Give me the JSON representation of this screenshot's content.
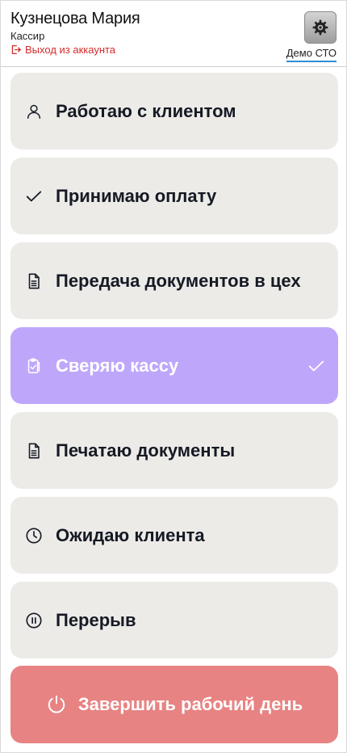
{
  "header": {
    "user_name": "Кузнецова Мария",
    "user_role": "Кассир",
    "logout_label": "Выход из аккаунта",
    "company": "Демо СТО"
  },
  "statuses": [
    {
      "label": "Работаю с клиентом",
      "icon": "person-icon",
      "active": false
    },
    {
      "label": "Принимаю оплату",
      "icon": "check-icon",
      "active": false
    },
    {
      "label": "Передача документов в цех",
      "icon": "document-icon",
      "active": false
    },
    {
      "label": "Сверяю кассу",
      "icon": "clipboard-check-icon",
      "active": true
    },
    {
      "label": "Печатаю документы",
      "icon": "document-icon",
      "active": false
    },
    {
      "label": "Ожидаю клиента",
      "icon": "clock-icon",
      "active": false
    },
    {
      "label": "Перерыв",
      "icon": "pause-icon",
      "active": false
    }
  ],
  "end_day": {
    "label": "Завершить рабочий день",
    "icon": "power-icon"
  },
  "colors": {
    "card_bg": "#edebe8",
    "active_bg": "#bea7fb",
    "end_day_bg": "#e88383",
    "logout_red": "#d62b2b",
    "accent_blue": "#2b8fd6"
  }
}
